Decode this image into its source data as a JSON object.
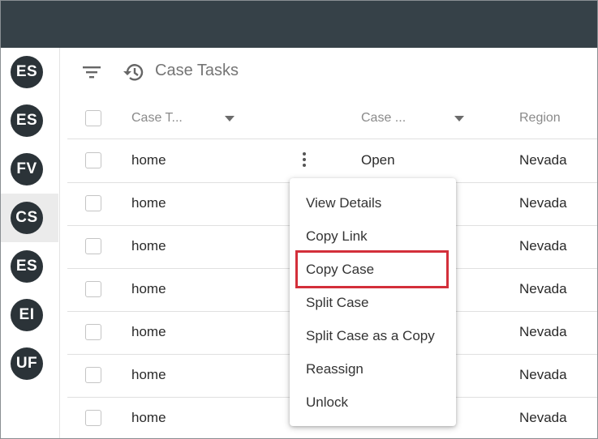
{
  "sidebar": {
    "items": [
      {
        "initials": "ES",
        "active": false
      },
      {
        "initials": "ES",
        "active": false
      },
      {
        "initials": "FV",
        "active": false
      },
      {
        "initials": "CS",
        "active": true
      },
      {
        "initials": "ES",
        "active": false
      },
      {
        "initials": "EI",
        "active": false
      },
      {
        "initials": "UF",
        "active": false
      }
    ]
  },
  "toolbar": {
    "title": "Case Tasks",
    "filter_icon": "filter-icon",
    "history_icon": "history-icon"
  },
  "table": {
    "columns": [
      "Case T...",
      "Case ...",
      "Region"
    ],
    "rows": [
      {
        "case_type": "home",
        "case_status": "Open",
        "region": "Nevada"
      },
      {
        "case_type": "home",
        "case_status": "",
        "region": "Nevada"
      },
      {
        "case_type": "home",
        "case_status": "",
        "region": "Nevada"
      },
      {
        "case_type": "home",
        "case_status": "",
        "region": "Nevada"
      },
      {
        "case_type": "home",
        "case_status": "",
        "region": "Nevada"
      },
      {
        "case_type": "home",
        "case_status": "",
        "region": "Nevada"
      },
      {
        "case_type": "home",
        "case_status": "",
        "region": "Nevada"
      }
    ]
  },
  "context_menu": {
    "items": [
      "View Details",
      "Copy Link",
      "Copy Case",
      "Split Case",
      "Split Case as a Copy",
      "Reassign",
      "Unlock"
    ],
    "highlighted": "Copy Case"
  },
  "colors": {
    "topbar": "#364148",
    "avatar": "#2b3338",
    "highlight": "#d32f3a"
  }
}
